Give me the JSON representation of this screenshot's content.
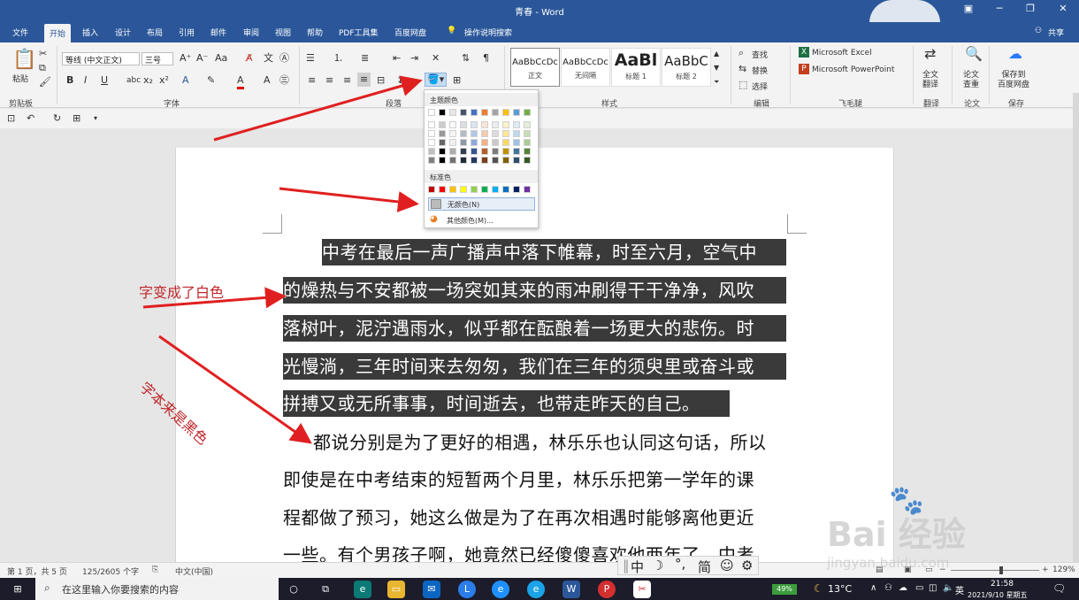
{
  "window": {
    "title": "青春 - Word"
  },
  "tabs": [
    {
      "label": "文件"
    },
    {
      "label": "开始"
    },
    {
      "label": "插入"
    },
    {
      "label": "设计"
    },
    {
      "label": "布局"
    },
    {
      "label": "引用"
    },
    {
      "label": "邮件"
    },
    {
      "label": "审阅"
    },
    {
      "label": "视图"
    },
    {
      "label": "帮助"
    },
    {
      "label": "PDF工具集"
    },
    {
      "label": "百度网盘"
    }
  ],
  "tell_me": "操作说明搜索",
  "share": "共享",
  "ribbon": {
    "clipboard": {
      "paste": "粘贴",
      "group": "剪贴板"
    },
    "font": {
      "name": "等线 (中文正文)",
      "size": "三号",
      "group": "字体"
    },
    "paragraph": {
      "group": "段落"
    },
    "styles": {
      "group": "样式",
      "items": [
        {
          "preview": "AaBbCcDc",
          "name": "正文"
        },
        {
          "preview": "AaBbCcDc",
          "name": "无间隔"
        },
        {
          "preview": "AaBl",
          "name": "标题 1"
        },
        {
          "preview": "AaBbC",
          "name": "标题 2"
        }
      ]
    },
    "editing": {
      "find": "查找",
      "replace": "替换",
      "select": "选择",
      "group": "编辑"
    },
    "feimao": {
      "excel": "Microsoft Excel",
      "ppt": "Microsoft PowerPoint",
      "group": "飞毛腿"
    },
    "translate": {
      "label": "全文\n翻译",
      "group": "翻译"
    },
    "paper": {
      "label": "论文\n查重",
      "group": "论文"
    },
    "save": {
      "label": "保存到\n百度网盘",
      "group": "保存"
    }
  },
  "shading_menu": {
    "theme_header": "主题颜色",
    "standard_header": "标准色",
    "no_color": "无颜色(N)",
    "more_colors": "其他颜色(M)...",
    "theme_colors": [
      "#ffffff",
      "#000000",
      "#e7e6e6",
      "#44546a",
      "#4472c4",
      "#ed7d31",
      "#a5a5a5",
      "#ffc000",
      "#5b9bd5",
      "#70ad47"
    ],
    "standard_colors": [
      "#c00000",
      "#ff0000",
      "#ffc000",
      "#ffff00",
      "#92d050",
      "#00b050",
      "#00b0f0",
      "#0070c0",
      "#002060",
      "#7030a0"
    ]
  },
  "document": {
    "highlighted_lines": [
      "中考在最后一声广播声中落下帷幕，时至六月，空气中",
      "的燥热与不安都被一场突如其来的雨冲刷得干干净净，风吹",
      "落树叶，泥泞遇雨水，似乎都在酝酿着一场更大的悲伤。时",
      "光慢淌，三年时间来去匆匆，我们在三年的须臾里或奋斗或",
      "拼搏又或无所事事，时间逝去，也带走昨天的自己。"
    ],
    "normal_lines": [
      "都说分别是为了更好的相遇，林乐乐也认同这句话，所以",
      "即使是在中考结束的短暂两个月里，林乐乐把第一学年的课",
      "程都做了预习，她这么做是为了在再次相遇时能够离他更近",
      "一些。有个男孩子啊，她竟然已经傻傻喜欢他两年了。中考"
    ]
  },
  "annotations": {
    "white": "字变成了白色",
    "black": "字本来是黑色"
  },
  "status": {
    "page": "第 1 页，共 5 页",
    "words": "125/2605 个字",
    "lang": "中文(中国)",
    "zoom": "129%"
  },
  "ime": {
    "mode": "中",
    "simp": "简"
  },
  "taskbar": {
    "search": "在这里输入你要搜索的内容",
    "battery": "49%",
    "temp": "13°C",
    "lang": "英",
    "time": "21:58",
    "date": "2021/9/10 星期五"
  },
  "watermark": {
    "brand": "Bai 经验",
    "url": "jingyan.baidu.com"
  }
}
